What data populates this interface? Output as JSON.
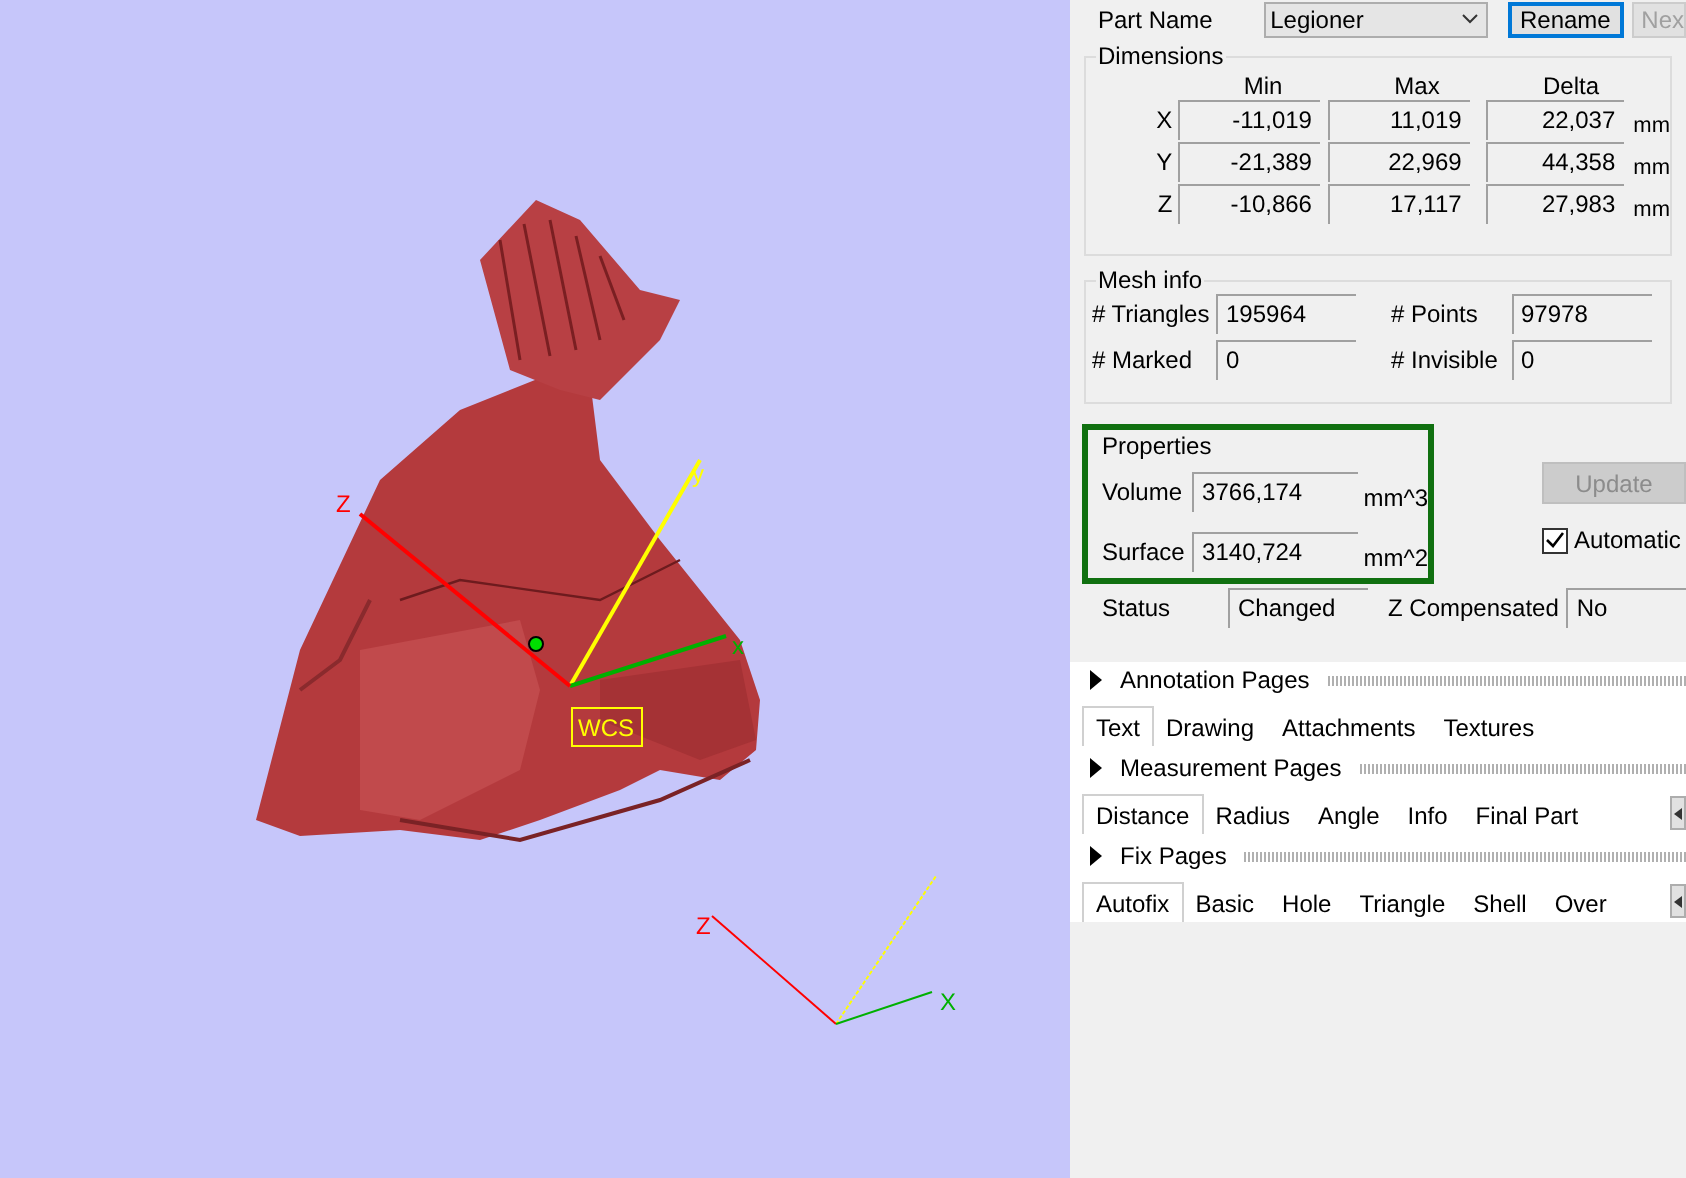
{
  "viewport": {
    "axes": [
      {
        "kind": "y",
        "label": "y"
      },
      {
        "kind": "x",
        "label": "x"
      },
      {
        "kind": "z",
        "label": "Z"
      }
    ],
    "wcs_label": "WCS",
    "triad": [
      {
        "kind": "z",
        "label": "Z"
      },
      {
        "kind": "x",
        "label": "X"
      }
    ]
  },
  "part": {
    "label": "Part Name",
    "value": "Legioner",
    "rename": "Rename",
    "next": "Nex"
  },
  "dimensions": {
    "title": "Dimensions",
    "columns": [
      "Min",
      "Max",
      "Delta"
    ],
    "rows": [
      {
        "axis": "X",
        "min": "-11,019",
        "max": "11,019",
        "delta": "22,037",
        "unit": "mm"
      },
      {
        "axis": "Y",
        "min": "-21,389",
        "max": "22,969",
        "delta": "44,358",
        "unit": "mm"
      },
      {
        "axis": "Z",
        "min": "-10,866",
        "max": "17,117",
        "delta": "27,983",
        "unit": "mm"
      }
    ]
  },
  "mesh_info": {
    "title": "Mesh info",
    "fields": [
      {
        "label": "# Triangles",
        "value": "195964"
      },
      {
        "label": "# Points",
        "value": "97978"
      },
      {
        "label": "# Marked",
        "value": "0"
      },
      {
        "label": "# Invisible",
        "value": "0"
      }
    ]
  },
  "properties": {
    "title": "Properties",
    "highlighted": true,
    "fields": [
      {
        "label": "Volume",
        "value": "3766,174",
        "unit": "mm^3"
      },
      {
        "label": "Surface",
        "value": "3140,724",
        "unit": "mm^2"
      }
    ],
    "update": {
      "label": "Update",
      "disabled": true
    },
    "automatic": {
      "label": "Automatic",
      "checked": true
    }
  },
  "status": {
    "label": "Status",
    "value": "Changed",
    "z_label": "Z Compensated",
    "z_value": "No"
  },
  "pages": [
    {
      "title": "Annotation Pages",
      "scroll_arrows": false,
      "tabs": [
        {
          "label": "Text",
          "selected": true
        },
        {
          "label": "Drawing",
          "selected": false
        },
        {
          "label": "Attachments",
          "selected": false
        },
        {
          "label": "Textures",
          "selected": false
        }
      ]
    },
    {
      "title": "Measurement Pages",
      "scroll_arrows": true,
      "tabs": [
        {
          "label": "Distance",
          "selected": true
        },
        {
          "label": "Radius",
          "selected": false
        },
        {
          "label": "Angle",
          "selected": false
        },
        {
          "label": "Info",
          "selected": false
        },
        {
          "label": "Final Part",
          "selected": false
        }
      ]
    },
    {
      "title": "Fix Pages",
      "scroll_arrows": true,
      "tabs": [
        {
          "label": "Autofix",
          "selected": true
        },
        {
          "label": "Basic",
          "selected": false
        },
        {
          "label": "Hole",
          "selected": false
        },
        {
          "label": "Triangle",
          "selected": false
        },
        {
          "label": "Shell",
          "selected": false
        },
        {
          "label": "Over",
          "selected": false
        }
      ]
    }
  ]
}
